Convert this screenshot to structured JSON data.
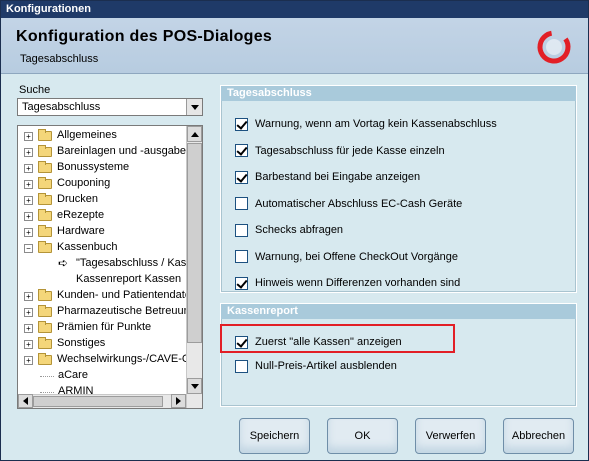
{
  "window": {
    "title": "Konfigurationen"
  },
  "header": {
    "title": "Konfiguration des POS-Dialoges",
    "subtitle": "Tagesabschluss",
    "logo_icon": "red-ring-logo"
  },
  "search": {
    "label": "Suche",
    "selected": "Tagesabschluss"
  },
  "tree": {
    "items": [
      {
        "label": "Allgemeines",
        "type": "folder",
        "expander": "+"
      },
      {
        "label": "Bareinlagen und -ausgaben",
        "type": "folder",
        "expander": "+"
      },
      {
        "label": "Bonussysteme",
        "type": "folder",
        "expander": "+"
      },
      {
        "label": "Couponing",
        "type": "folder",
        "expander": "+"
      },
      {
        "label": "Drucken",
        "type": "folder",
        "expander": "+"
      },
      {
        "label": "eRezepte",
        "type": "folder",
        "expander": "+"
      },
      {
        "label": "Hardware",
        "type": "folder",
        "expander": "+"
      },
      {
        "label": "Kassenbuch",
        "type": "folder",
        "expander": "−"
      },
      {
        "label": "\"Tagesabschluss / Kass",
        "type": "child-selected"
      },
      {
        "label": "Kassenreport Kassen",
        "type": "child"
      },
      {
        "label": "Kunden- und Patientendatei",
        "type": "folder",
        "expander": "+"
      },
      {
        "label": "Pharmazeutische Betreuung",
        "type": "folder",
        "expander": "+"
      },
      {
        "label": "Prämien für Punkte",
        "type": "folder",
        "expander": "+"
      },
      {
        "label": "Sonstiges",
        "type": "folder",
        "expander": "+"
      },
      {
        "label": "Wechselwirkungs-/CAVE-Ch",
        "type": "folder",
        "expander": "+"
      },
      {
        "label": "aCare",
        "type": "plain"
      },
      {
        "label": "ARMIN",
        "type": "plain"
      }
    ]
  },
  "tagesabschluss": {
    "title": "Tagesabschluss",
    "options": [
      {
        "label": "Warnung, wenn am Vortag kein Kassenabschluss",
        "checked": true
      },
      {
        "label": "Tagesabschluss für jede Kasse einzeln",
        "checked": true
      },
      {
        "label": "Barbestand bei Eingabe anzeigen",
        "checked": true
      },
      {
        "label": "Automatischer Abschluss EC-Cash Geräte",
        "checked": false
      },
      {
        "label": "Schecks abfragen",
        "checked": false
      },
      {
        "label": "Warnung, bei Offene CheckOut Vorgänge",
        "checked": false
      },
      {
        "label": "Hinweis wenn Differenzen vorhanden sind",
        "checked": true
      }
    ]
  },
  "kassenreport": {
    "title": "Kassenreport",
    "options": [
      {
        "label": "Zuerst \"alle Kassen\" anzeigen",
        "checked": true
      },
      {
        "label": "Null-Preis-Artikel ausblenden",
        "checked": false
      }
    ]
  },
  "buttons": {
    "save": "Speichern",
    "ok": "OK",
    "discard": "Verwerfen",
    "cancel": "Abbrechen"
  },
  "colors": {
    "titlebar": "#1f3a68",
    "panel": "#d7e9ef",
    "group_header": "#a9cadb",
    "highlight": "#e21f26"
  }
}
